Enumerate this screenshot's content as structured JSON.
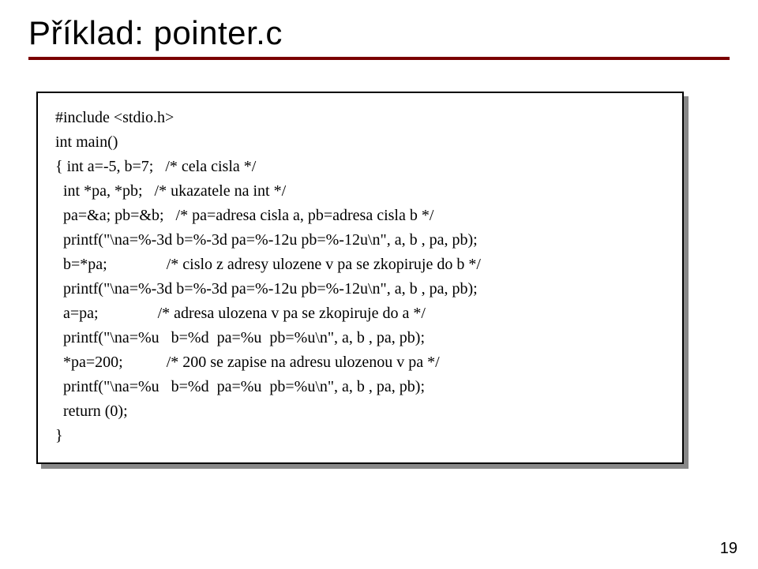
{
  "title": "Příklad: pointer.c",
  "code": {
    "l0": "#include <stdio.h>",
    "l1": "int main()",
    "l2": "{ int a=-5, b=7;   /* cela cisla */",
    "l3": "  int *pa, *pb;   /* ukazatele na int */",
    "l4": "  pa=&a; pb=&b;   /* pa=adresa cisla a, pb=adresa cisla b */",
    "l5": "  printf(\"\\na=%-3d b=%-3d pa=%-12u pb=%-12u\\n\", a, b , pa, pb);",
    "l6": "  b=*pa;               /* cislo z adresy ulozene v pa se zkopiruje do b */",
    "l7": "  printf(\"\\na=%-3d b=%-3d pa=%-12u pb=%-12u\\n\", a, b , pa, pb);",
    "l8": "  a=pa;               /* adresa ulozena v pa se zkopiruje do a */",
    "l9": "  printf(\"\\na=%u   b=%d  pa=%u  pb=%u\\n\", a, b , pa, pb);",
    "l10": "  *pa=200;           /* 200 se zapise na adresu ulozenou v pa */",
    "l11": "  printf(\"\\na=%u   b=%d  pa=%u  pb=%u\\n\", a, b , pa, pb);",
    "l12": "  return (0);",
    "l13": "}"
  },
  "page_number": "19"
}
